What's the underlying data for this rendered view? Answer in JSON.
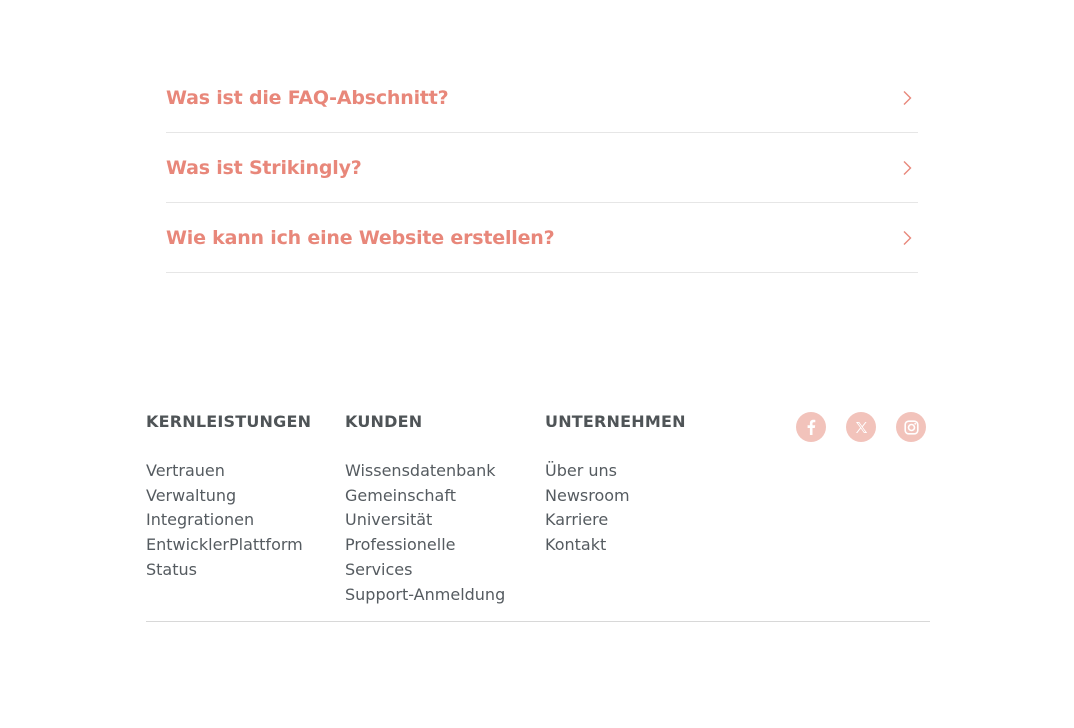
{
  "faq": {
    "items": [
      {
        "question": "Was ist die FAQ-Abschnitt?"
      },
      {
        "question": "Was ist Strikingly?"
      },
      {
        "question": "Wie kann ich eine Website erstellen?"
      }
    ]
  },
  "footer": {
    "columns": [
      {
        "heading": "KERNLEISTUNGEN",
        "links": [
          "Vertrauen",
          "Verwaltung",
          "Integrationen",
          "EntwicklerPlattform",
          "Status"
        ]
      },
      {
        "heading": "KUNDEN",
        "links": [
          "Wissensdatenbank",
          "Gemeinschaft",
          "Universität",
          "Professionelle Services",
          "Support-Anmeldung"
        ]
      },
      {
        "heading": "UNTERNEHMEN",
        "links": [
          "Über uns",
          "Newsroom",
          "Karriere",
          "Kontakt"
        ]
      }
    ],
    "socials": [
      {
        "icon": "facebook-icon"
      },
      {
        "icon": "x-twitter-icon"
      },
      {
        "icon": "instagram-icon"
      }
    ]
  },
  "colors": {
    "accent": "#e8877a",
    "social_bg": "#f2c3bb",
    "heading": "#4f5457",
    "text": "#555b60"
  }
}
